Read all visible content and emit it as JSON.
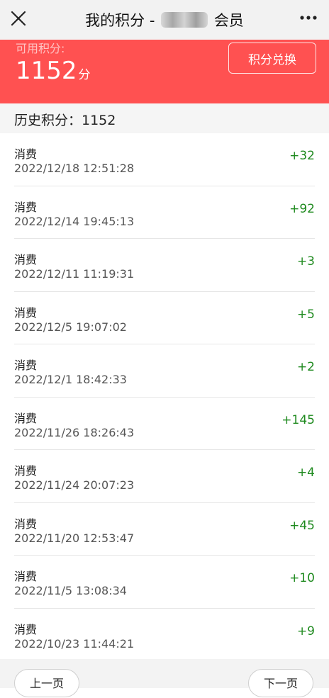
{
  "nav": {
    "title_left": "我的积分 -",
    "title_right": "会员"
  },
  "balance": {
    "label": "可用积分:",
    "points": "1152",
    "unit": "分",
    "redeem_label": "积分兑换"
  },
  "history": {
    "text": "历史积分：1152"
  },
  "records": [
    {
      "type": "消费",
      "time": "2022/12/18 12:51:28",
      "delta": "+32"
    },
    {
      "type": "消费",
      "time": "2022/12/14 19:45:13",
      "delta": "+92"
    },
    {
      "type": "消费",
      "time": "2022/12/11 11:19:31",
      "delta": "+3"
    },
    {
      "type": "消费",
      "time": "2022/12/5 19:07:02",
      "delta": "+5"
    },
    {
      "type": "消费",
      "time": "2022/12/1 18:42:33",
      "delta": "+2"
    },
    {
      "type": "消费",
      "time": "2022/11/26 18:26:43",
      "delta": "+145"
    },
    {
      "type": "消费",
      "time": "2022/11/24 20:07:23",
      "delta": "+4"
    },
    {
      "type": "消费",
      "time": "2022/11/20 12:53:47",
      "delta": "+45"
    },
    {
      "type": "消费",
      "time": "2022/11/5 13:08:34",
      "delta": "+10"
    },
    {
      "type": "消费",
      "time": "2022/10/23 11:44:21",
      "delta": "+9"
    }
  ],
  "pager": {
    "prev_label": "上一页",
    "next_label": "下一页"
  },
  "colors": {
    "banner": "#ff5151",
    "positive": "#1f8a1f"
  }
}
